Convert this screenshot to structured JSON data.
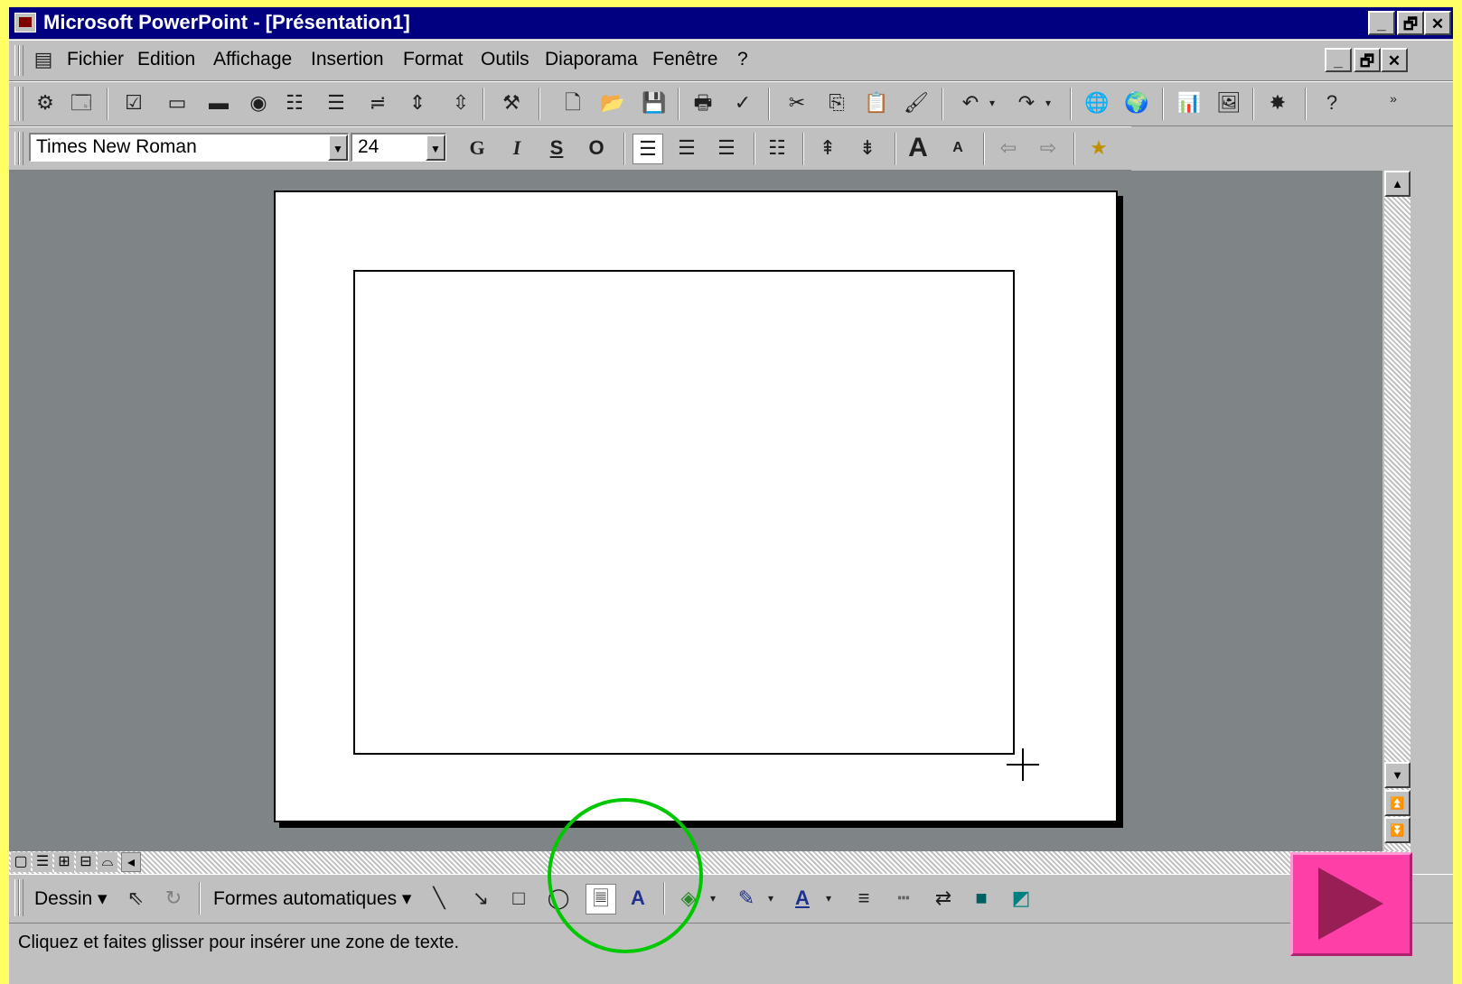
{
  "window": {
    "title": "Microsoft PowerPoint - [Présentation1]",
    "controls": {
      "minimize": "_",
      "maximize": "🗗",
      "close": "✕"
    }
  },
  "menu": {
    "items": [
      "Fichier",
      "Edition",
      "Affichage",
      "Insertion",
      "Format",
      "Outils",
      "Diaporama",
      "Fenêtre",
      "?"
    ]
  },
  "formatting": {
    "font_name": "Times New Roman",
    "font_size": "24",
    "bold_label": "G",
    "italic_label": "I",
    "underline_label": "S",
    "shadow_label": "O"
  },
  "drawing": {
    "draw_menu": "Dessin ▾",
    "autoshapes_menu": "Formes automatiques ▾"
  },
  "status": {
    "message": "Cliquez et faites glisser pour insérer une zone de texte."
  },
  "colors": {
    "titlebar": "#000080",
    "workspace": "#7f8586",
    "highlight": "#00c800",
    "next_button": "#ff3fa8"
  }
}
